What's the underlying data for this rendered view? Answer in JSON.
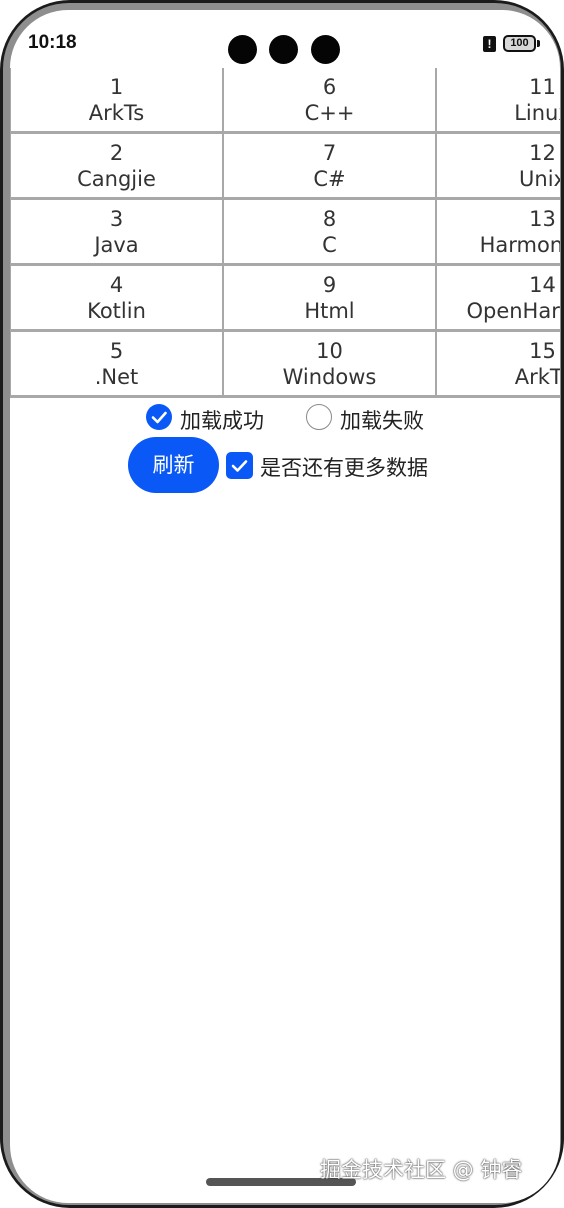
{
  "status_bar": {
    "time": "10:18",
    "alert_glyph": "!",
    "battery": "100"
  },
  "grid": {
    "columns": [
      [
        {
          "number": "1",
          "label": "ArkTs"
        },
        {
          "number": "2",
          "label": "Cangjie"
        },
        {
          "number": "3",
          "label": "Java"
        },
        {
          "number": "4",
          "label": "Kotlin"
        },
        {
          "number": "5",
          "label": ".Net"
        }
      ],
      [
        {
          "number": "6",
          "label": "C++"
        },
        {
          "number": "7",
          "label": "C#"
        },
        {
          "number": "8",
          "label": "C"
        },
        {
          "number": "9",
          "label": "Html"
        },
        {
          "number": "10",
          "label": "Windows"
        }
      ],
      [
        {
          "number": "11",
          "label": "Linux"
        },
        {
          "number": "12",
          "label": "Unix"
        },
        {
          "number": "13",
          "label": "HarmonyOS"
        },
        {
          "number": "14",
          "label": "OpenHarmony"
        },
        {
          "number": "15",
          "label": "ArkTs"
        }
      ]
    ]
  },
  "load_options": {
    "success_label": "加载成功",
    "fail_label": "加载失败",
    "selected": "success"
  },
  "actions": {
    "refresh_label": "刷新",
    "has_more_label": "是否还有更多数据",
    "has_more_checked": true
  },
  "watermark": "掘金技术社区 @ 钟睿",
  "colors": {
    "accent": "#0a59f7",
    "grid_border": "#a8a8a8"
  }
}
